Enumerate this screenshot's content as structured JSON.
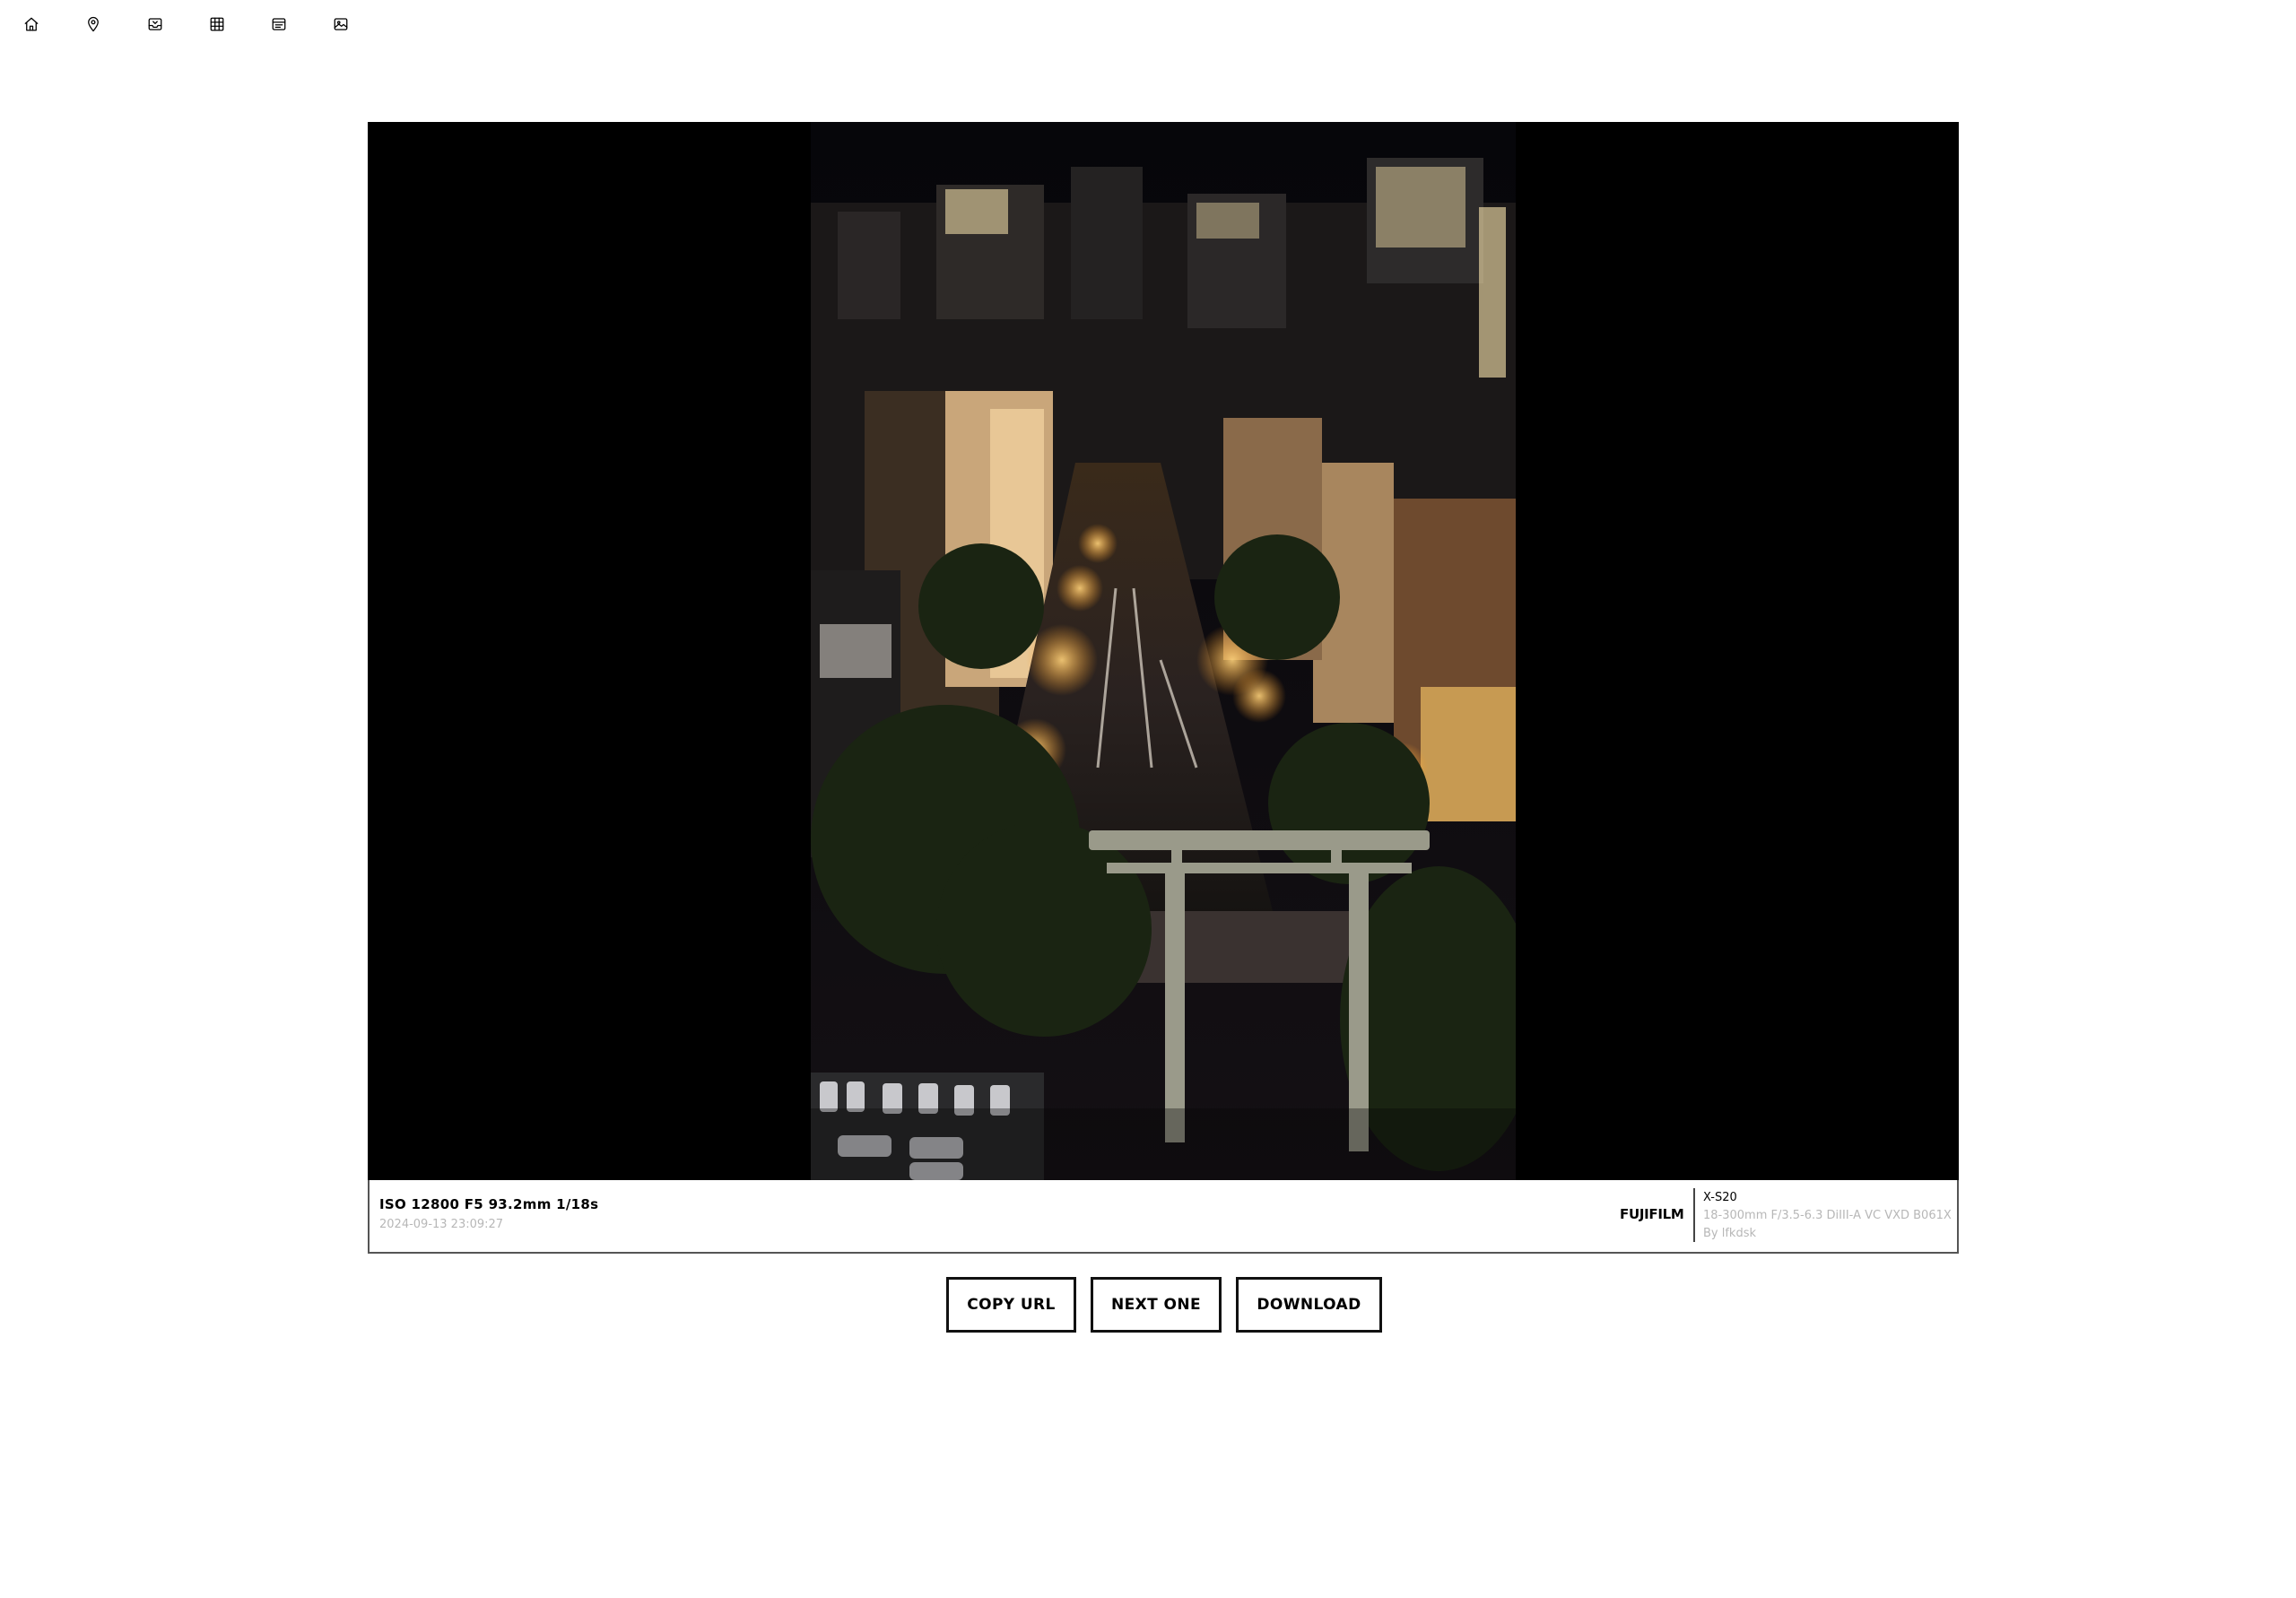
{
  "nav": {
    "items": [
      {
        "name": "home",
        "icon": "home-icon"
      },
      {
        "name": "map",
        "icon": "map-pin-icon"
      },
      {
        "name": "inbox",
        "icon": "inbox-icon"
      },
      {
        "name": "grid",
        "icon": "grid-icon"
      },
      {
        "name": "list",
        "icon": "list-icon"
      },
      {
        "name": "photo",
        "icon": "image-icon"
      }
    ]
  },
  "photo": {
    "exif": "ISO 12800 F5 93.2mm 1/18s",
    "datetime": "2024-09-13 23:09:27",
    "brand": "FUJIFILM",
    "camera": "X-S20",
    "lens": "18-300mm F/3.5-6.3 DiIII-A VC VXD B061X",
    "author": "By lfkdsk"
  },
  "actions": {
    "copy_url": "COPY URL",
    "next_one": "NEXT ONE",
    "download": "DOWNLOAD"
  },
  "colors": {
    "viewer_background": "#000000",
    "text_muted": "#b7b7b7",
    "button_border": "#111111"
  }
}
